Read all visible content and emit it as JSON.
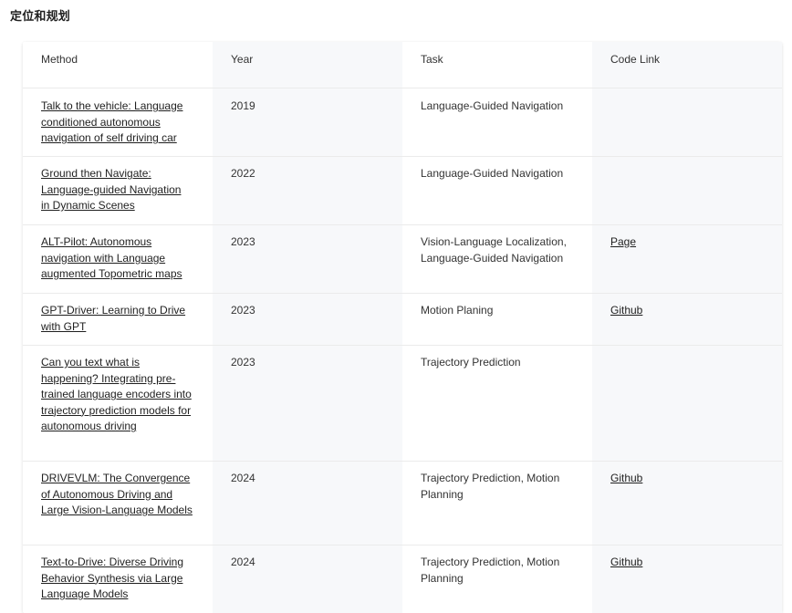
{
  "section": {
    "title": "定位和规划"
  },
  "table": {
    "headers": {
      "method": "Method",
      "year": "Year",
      "task": "Task",
      "code": "Code Link"
    },
    "rows": [
      {
        "method": "Talk to the vehicle: Language conditioned autonomous navigation of self driving car",
        "year": "2019",
        "task": "Language-Guided Navigation",
        "code": ""
      },
      {
        "method": "Ground then Navigate: Language-guided Navigation in Dynamic Scenes",
        "year": "2022",
        "task": "Language-Guided Navigation",
        "code": ""
      },
      {
        "method": "ALT-Pilot: Autonomous navigation with Language augmented Topometric maps",
        "year": "2023",
        "task": "Vision-Language Localization, Language-Guided Navigation",
        "code": "Page"
      },
      {
        "method": "GPT-Driver: Learning to Drive with GPT",
        "year": "2023",
        "task": "Motion Planing",
        "code": "Github"
      },
      {
        "method": "Can you text what is happening? Integrating pre-trained language encoders into trajectory prediction models for autonomous driving",
        "year": "2023",
        "task": "Trajectory Prediction",
        "code": ""
      },
      {
        "method": "DRIVEVLM: The Convergence of Autonomous Driving and Large Vision-Language Models",
        "year": "2024",
        "task": "Trajectory Prediction, Motion Planning",
        "code": "Github"
      },
      {
        "method": "Text-to-Drive: Diverse Driving Behavior Synthesis via Large Language Models",
        "year": "2024",
        "task": "Trajectory Prediction, Motion Planning",
        "code": "Github"
      }
    ]
  }
}
